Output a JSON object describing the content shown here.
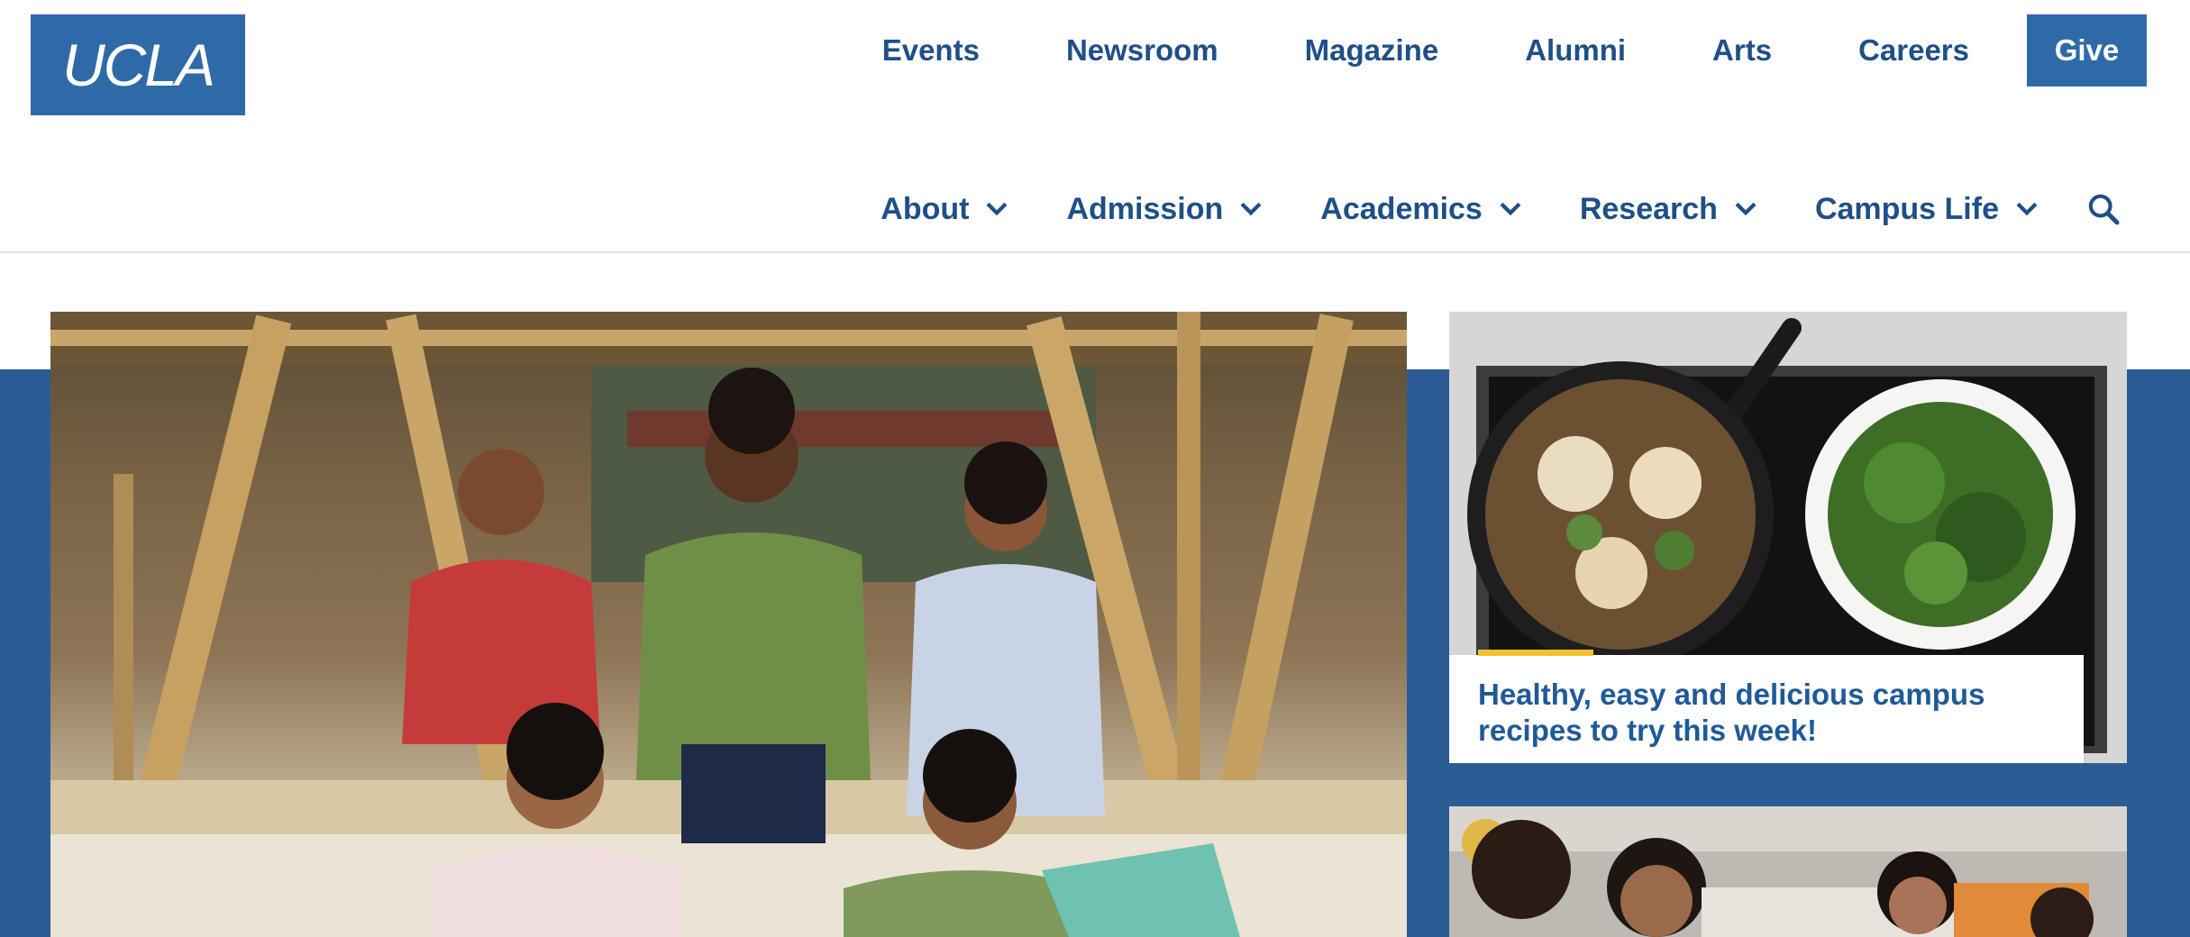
{
  "brand": {
    "logo_text": "UCLA"
  },
  "utility_nav": {
    "links": [
      "Events",
      "Newsroom",
      "Magazine",
      "Alumni",
      "Arts",
      "Careers"
    ],
    "give_label": "Give"
  },
  "main_nav": {
    "items": [
      {
        "label": "About",
        "icon": "chevron-down-icon"
      },
      {
        "label": "Admission",
        "icon": "chevron-down-icon"
      },
      {
        "label": "Academics",
        "icon": "chevron-down-icon"
      },
      {
        "label": "Research",
        "icon": "chevron-down-icon"
      },
      {
        "label": "Campus Life",
        "icon": "chevron-down-icon"
      }
    ],
    "search_icon": "search-icon"
  },
  "featured": {
    "cards": [
      {
        "title": "Healthy, easy and delicious campus recipes to try this week!"
      }
    ]
  },
  "colors": {
    "brand_blue": "#2f6aa8",
    "band_blue": "#2b5c93",
    "link_blue": "#1f4f88",
    "accent_gold": "#f2c230"
  }
}
